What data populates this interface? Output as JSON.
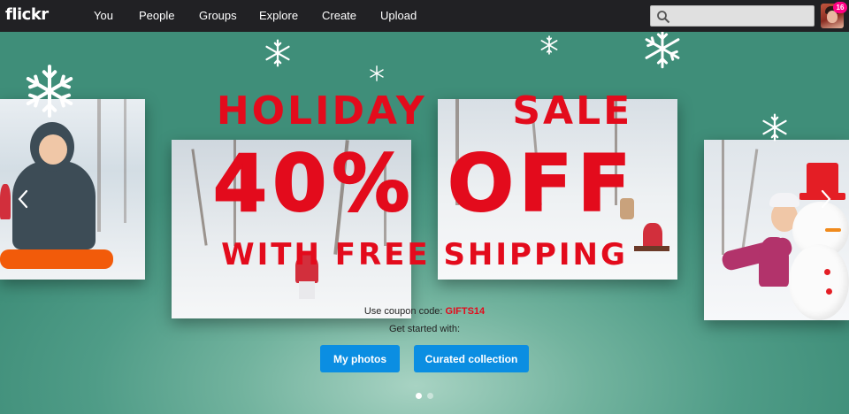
{
  "topbar": {
    "logo": "flickr",
    "nav": [
      "You",
      "People",
      "Groups",
      "Explore",
      "Create",
      "Upload"
    ],
    "search": {
      "placeholder": "",
      "value": ""
    },
    "notification_count": "16"
  },
  "hero": {
    "line1": "HOLIDAY  SALE",
    "line2": "40% OFF",
    "line3": "WITH FREE SHIPPING",
    "coupon_label": "Use coupon code: ",
    "coupon_code": "GIFTS14",
    "get_started": "Get started with:",
    "button_my_photos": "My photos",
    "button_curated": "Curated collection",
    "slide_count": 2,
    "active_slide": 1
  },
  "colors": {
    "topbar": "#212124",
    "sale_red": "#e30b1c",
    "button_blue": "#0b8ee2",
    "background_green": "#4d9b86",
    "badge_pink": "#ff0084"
  },
  "icons": [
    "search-icon",
    "snowflake-icon",
    "chevron-left-icon",
    "chevron-right-icon"
  ]
}
